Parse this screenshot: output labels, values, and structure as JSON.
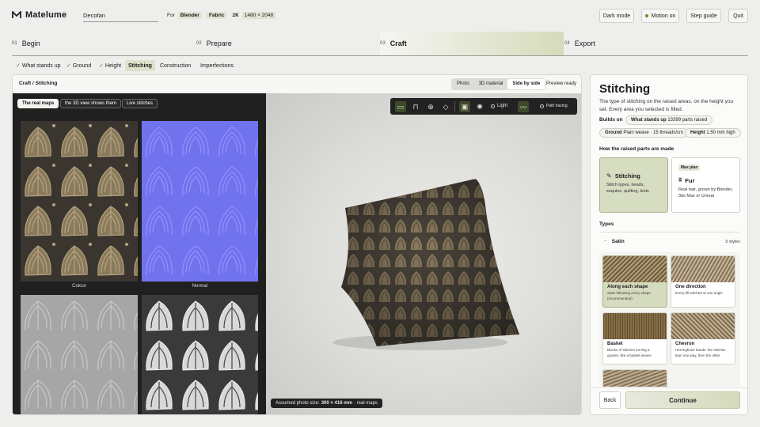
{
  "app": {
    "name": "Matelume",
    "project_name": "Decofan",
    "for_label": "For",
    "for_value": "Blender",
    "fabric": "Fabric",
    "res": "2K",
    "dims": "1480 × 2048"
  },
  "header": {
    "dark_mode": "Dark mode",
    "motion": "Motion on",
    "step_guide": "Step guide",
    "quit": "Quit"
  },
  "steps": [
    {
      "num": "01",
      "label": "Begin"
    },
    {
      "num": "02",
      "label": "Prepare"
    },
    {
      "num": "03",
      "label": "Craft"
    },
    {
      "num": "04",
      "label": "Export"
    }
  ],
  "subtabs": {
    "what_stands_up": "What stands up",
    "ground": "Ground",
    "height": "Height",
    "stitching": "Stitching",
    "construction": "Construction",
    "imperfections": "Imperfections"
  },
  "workspace": {
    "breadcrumb": "Craft / Stitching",
    "view_photo": "Photo",
    "view_3d": "3D material",
    "view_side": "Side by side",
    "status": "Preview ready",
    "maps_tabs": {
      "real_maps": "The real maps",
      "view_shows": "the 3D view shows them",
      "live": "Live stitches"
    },
    "map_labels": {
      "colour": "Colour",
      "normal": "Normal"
    },
    "viewer": {
      "light": "Light",
      "path": "Path tracing"
    },
    "assumed_prefix": "Assumed photo size:",
    "assumed_value": "300 × 416 mm",
    "assumed_suffix": "· real maps"
  },
  "panel": {
    "title": "Stitching",
    "desc": "The type of stitching on the raised areas, on the height you set. Every area you selected is filled.",
    "builds_on": "Builds on",
    "wsu_label": "What stands up",
    "wsu_value": "13399 parts raised",
    "ground_label": "Ground",
    "ground_value": "Plain weave · 15 threads/cm",
    "height_label": "Height",
    "height_value": "1.50 mm high",
    "how_made": "How the raised parts are made",
    "opt_stitch_title": "Stitching",
    "opt_stitch_desc": "Stitch types, beads, sequins, quilting, knits",
    "opt_fur_badge": "Max plan",
    "opt_fur_title": "Fur",
    "opt_fur_desc": "Real hair, grown by Blender, 3ds Max or Unreal",
    "types": "Types",
    "satin": "Satin",
    "styles_count": "5 styles",
    "styles": [
      {
        "title": "Along each shape",
        "desc": "Satin following every shape (recommended)"
      },
      {
        "title": "One direction",
        "desc": "Every fill stitched at one angle"
      },
      {
        "title": "Basket",
        "desc": "Blocks of stitches turning a quarter, like a basket weave"
      },
      {
        "title": "Chevron",
        "desc": "Herringbone bands: the stitches lean one way, then the other"
      }
    ],
    "back": "Back",
    "continue": "Continue"
  },
  "colors": {
    "accent": "#d3dbb8",
    "dark": "#1f1f1f",
    "normal_map": "#6f72f0"
  }
}
